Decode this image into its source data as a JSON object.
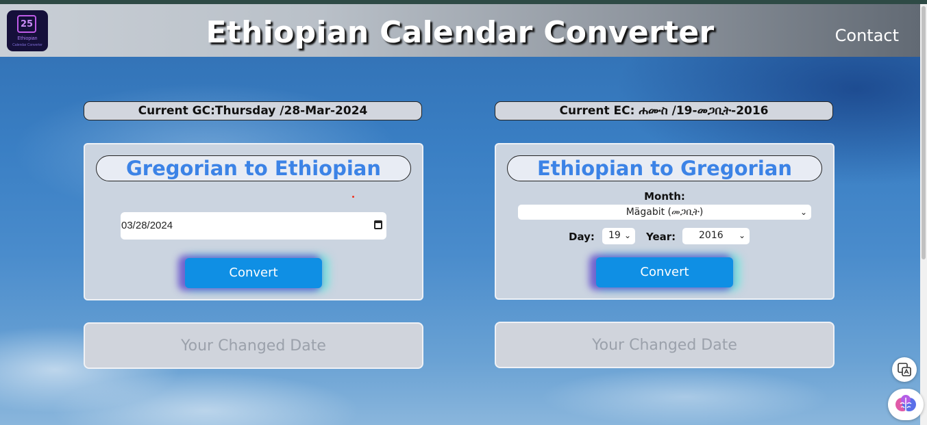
{
  "header": {
    "logo": {
      "number": "25",
      "line1": "Ethiopian",
      "line2": "Calendar Converter"
    },
    "title": "Ethiopian Calendar Converter",
    "contact_label": "Contact"
  },
  "left": {
    "current_label": "Current GC:Thursday /28-Mar-2024",
    "panel_title": "Gregorian to Ethiopian",
    "date_value": "03/28/2024",
    "convert_label": "Convert",
    "result_placeholder": "Your Changed Date"
  },
  "right": {
    "current_label": "Current EC: ሐሙስ /19-መጋቢት-2016",
    "panel_title": "Ethiopian to Gregorian",
    "month_label": "Month:",
    "month_value": "Mägabit (መጋቢት)",
    "day_label": "Day:",
    "day_value": "19",
    "year_label": "Year:",
    "year_value": "2016",
    "convert_label": "Convert",
    "result_placeholder": "Your Changed Date"
  },
  "icons": {
    "translate": "translate-icon",
    "brain": "brain-icon",
    "calendar": "calendar-icon",
    "chevron": "chevron-down-icon"
  },
  "colors": {
    "accent_blue": "#3c83e6",
    "button_blue": "#0f8fe4"
  }
}
